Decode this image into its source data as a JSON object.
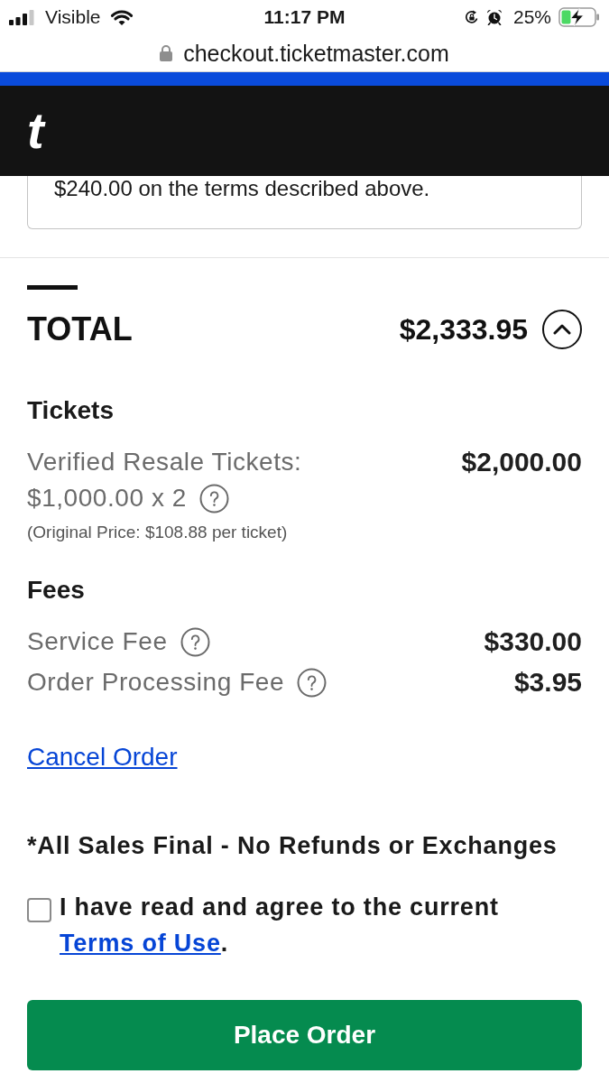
{
  "status_bar": {
    "carrier": "Visible",
    "time": "11:17 PM",
    "battery": "25%"
  },
  "address_bar": {
    "url": "checkout.ticketmaster.com"
  },
  "header": {
    "logo": "t"
  },
  "terms_box": {
    "text": "$240.00 on the terms described above."
  },
  "total": {
    "label": "TOTAL",
    "amount": "$2,333.95",
    "expanded": true
  },
  "sections": [
    {
      "heading": "Tickets",
      "items": [
        {
          "label": "Verified Resale Tickets:",
          "sublabel": "$1,000.00 x 2",
          "note": "(Original Price: $108.88 per ticket)",
          "amount": "$2,000.00",
          "info": true
        }
      ]
    },
    {
      "heading": "Fees",
      "items": [
        {
          "label": "Service Fee",
          "amount": "$330.00",
          "info": true
        },
        {
          "label": "Order Processing Fee",
          "amount": "$3.95",
          "info": true
        }
      ]
    }
  ],
  "cancel_link": "Cancel Order",
  "notice": "*All Sales Final - No Refunds or Exchanges",
  "agreement": {
    "checked": false,
    "text": "I have read and agree to the current",
    "link": "Terms of Use",
    "suffix": "."
  },
  "place_order_button": "Place Order"
}
